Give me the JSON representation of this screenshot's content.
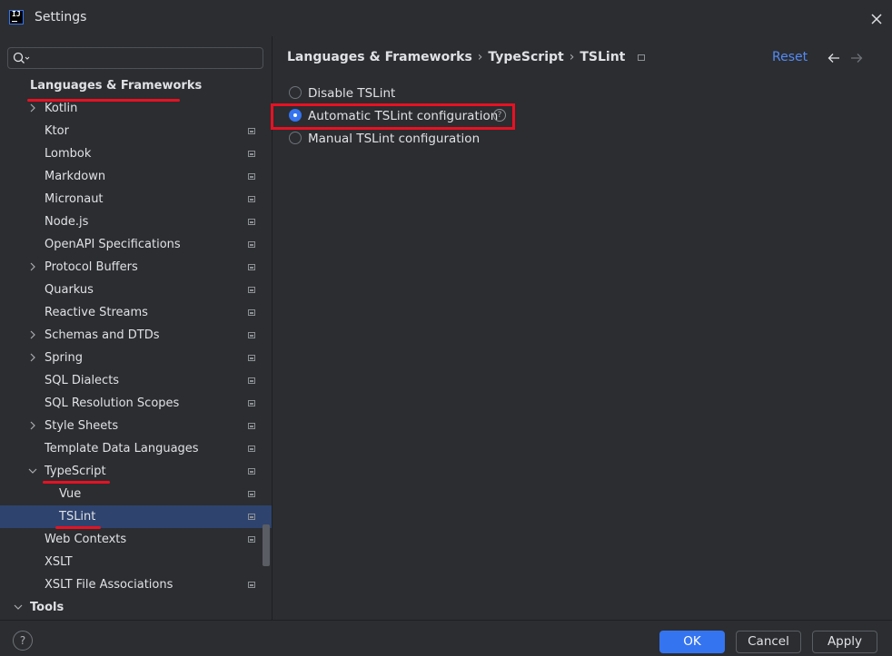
{
  "window": {
    "title": "Settings"
  },
  "search": {
    "placeholder": "",
    "value": ""
  },
  "tree": {
    "section_title": "Languages & Frameworks",
    "items": [
      {
        "label": "Kotlin"
      },
      {
        "label": "Ktor"
      },
      {
        "label": "Lombok"
      },
      {
        "label": "Markdown"
      },
      {
        "label": "Micronaut"
      },
      {
        "label": "Node.js"
      },
      {
        "label": "OpenAPI Specifications"
      },
      {
        "label": "Protocol Buffers"
      },
      {
        "label": "Quarkus"
      },
      {
        "label": "Reactive Streams"
      },
      {
        "label": "Schemas and DTDs"
      },
      {
        "label": "Spring"
      },
      {
        "label": "SQL Dialects"
      },
      {
        "label": "SQL Resolution Scopes"
      },
      {
        "label": "Style Sheets"
      },
      {
        "label": "Template Data Languages"
      },
      {
        "label": "TypeScript"
      },
      {
        "label": "Vue"
      },
      {
        "label": "TSLint",
        "selected": true
      },
      {
        "label": "Web Contexts"
      },
      {
        "label": "XSLT"
      },
      {
        "label": "XSLT File Associations"
      },
      {
        "label": "Tools"
      }
    ]
  },
  "breadcrumb": {
    "items": [
      "Languages & Frameworks",
      "TypeScript",
      "TSLint"
    ],
    "reset_label": "Reset"
  },
  "tslint_options": {
    "disable_label": "Disable TSLint",
    "automatic_label": "Automatic TSLint configuration",
    "manual_label": "Manual TSLint configuration",
    "selected": "Automatic TSLint configuration"
  },
  "footer": {
    "help_label": "?",
    "ok_label": "OK",
    "cancel_label": "Cancel",
    "apply_label": "Apply"
  },
  "colors": {
    "background": "#2b2d30",
    "accent": "#3574f0",
    "selection": "#2e436e",
    "annotation_red": "#e81123",
    "link": "#548af7"
  }
}
